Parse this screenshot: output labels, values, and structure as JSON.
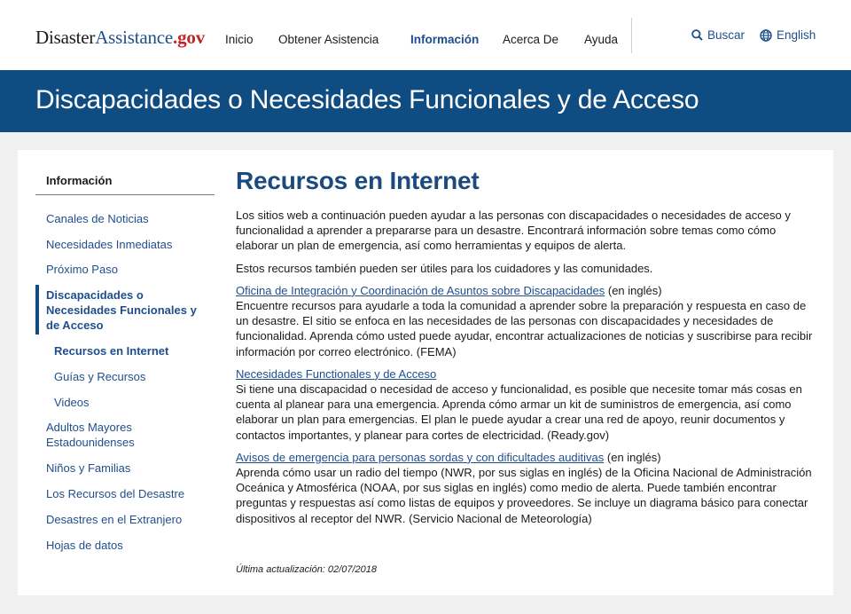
{
  "header": {
    "logo_text_1": "Disaster",
    "logo_text_2": "Assistance",
    "logo_text_3": ".gov",
    "nav": [
      "Inicio",
      "Obtener Asistencia",
      "Información",
      "Acerca De",
      "Ayuda"
    ],
    "search_label": "Buscar",
    "language_label": "English",
    "colors": {
      "brand_blue": "#0f4c81",
      "link_blue": "#1f4e8c",
      "accent_red": "#c0242b"
    }
  },
  "banner": {
    "title": "Discapacidades o Necesidades Funcionales y de Acceso"
  },
  "sidebar": {
    "title": "Información",
    "items": [
      "Canales de Noticias",
      "Necesidades Inmediatas",
      "Próximo Paso",
      "Discapacidades o Necesidades Funcionales y de Acceso",
      "Recursos en Internet",
      "Guías y Recursos",
      "Videos",
      "Adultos Mayores Estadounidenses",
      "Niños y Familias",
      "Los Recursos del Desastre",
      "Desastres en el Extranjero",
      "Hojas de datos"
    ]
  },
  "main": {
    "heading": "Recursos en Internet",
    "intro": "Los sitios web a continuación pueden ayudar a las personas con discapacidades o necesidades de acceso y funcionalidad a aprender a prepararse para un desastre. Encontrará información sobre temas como cómo elaborar un plan de emergencia, así como herramientas y equipos de alerta.",
    "note": "Estos recursos también pueden ser útiles para los cuidadores y las comunidades.",
    "resources": [
      {
        "link": "Oficina de Integración y Coordinación de Asuntos sobre Discapacidades",
        "suffix": " (en inglés)",
        "desc": "Encuentre recursos para ayudarle a toda la comunidad a aprender sobre la preparación y respuesta en caso de un desastre. El sitio se enfoca en las necesidades de las personas con discapacidades y necesidades de funcionalidad. Aprenda cómo usted puede ayudar, encontrar actualizaciones de noticias y suscribirse para recibir información por correo electrónico. (FEMA)"
      },
      {
        "link": "Necesidades Functionales y de Acceso",
        "suffix": "",
        "desc": "Si tiene una discapacidad o necesidad de acceso y funcionalidad, es posible que necesite tomar más cosas en cuenta al planear para una emergencia. Aprenda cómo armar un kit de suministros de emergencia, así como elaborar un plan para emergencias. El plan le puede ayudar a crear una red de apoyo, reunir documentos y contactos importantes, y planear para cortes de electricidad. (Ready.gov)"
      },
      {
        "link": "Avisos de emergencia para personas sordas y con dificultades auditivas",
        "suffix": " (en inglés)",
        "desc": "Aprenda cómo usar un radio del tiempo (NWR, por sus siglas en inglés) de la Oficina Nacional de Administración Oceánica y Atmosférica (NOAA, por sus siglas en inglés) como medio de alerta. Puede también encontrar preguntas y respuestas así como listas de equipos y proveedores. Se incluye un diagrama básico para conectar dispositivos al receptor del NWR. (Servicio Nacional de Meteorología)"
      }
    ],
    "updated": "Última actualización: 02/07/2018"
  }
}
